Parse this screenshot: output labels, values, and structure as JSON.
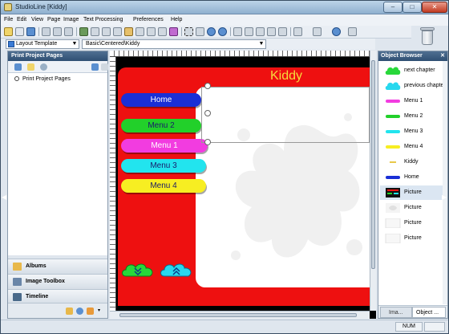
{
  "window": {
    "title": "StudioLine [Kiddy]"
  },
  "menu": [
    "File",
    "Edit",
    "View",
    "Page",
    "Image",
    "Text Processing",
    "Preferences",
    "Help"
  ],
  "selectors": {
    "template": "Layout Template",
    "path": "Basic\\Centered\\Kiddy"
  },
  "left_panel": {
    "title": "Print Project Pages",
    "tree_items": [
      "Print Project Pages"
    ],
    "sections": [
      "Albums",
      "Image Toolbox",
      "Timeline"
    ]
  },
  "page": {
    "site_title": "Kiddy",
    "menu_items": [
      "Home",
      "Menu 2",
      "Menu 1",
      "Menu 3",
      "Menu 4"
    ]
  },
  "object_browser": {
    "title": "Object Browser",
    "items": [
      "next chapter",
      "previous chapter",
      "Menu 1",
      "Menu 2",
      "Menu 3",
      "Menu 4",
      "Kiddy",
      "Home",
      "Picture",
      "Picture",
      "Picture",
      "Picture"
    ],
    "tabs": [
      "Ima...",
      "Object ..."
    ]
  },
  "status": {
    "num": "NUM"
  },
  "colors": {
    "page_red": "#ee1010",
    "title_yellow": "#f7dc3c",
    "home_blue": "#1a2fd6",
    "menu_green": "#22d02a",
    "menu_magenta": "#f23ce0",
    "menu_cyan": "#22e4ee",
    "menu_yellow": "#f7ee22"
  }
}
